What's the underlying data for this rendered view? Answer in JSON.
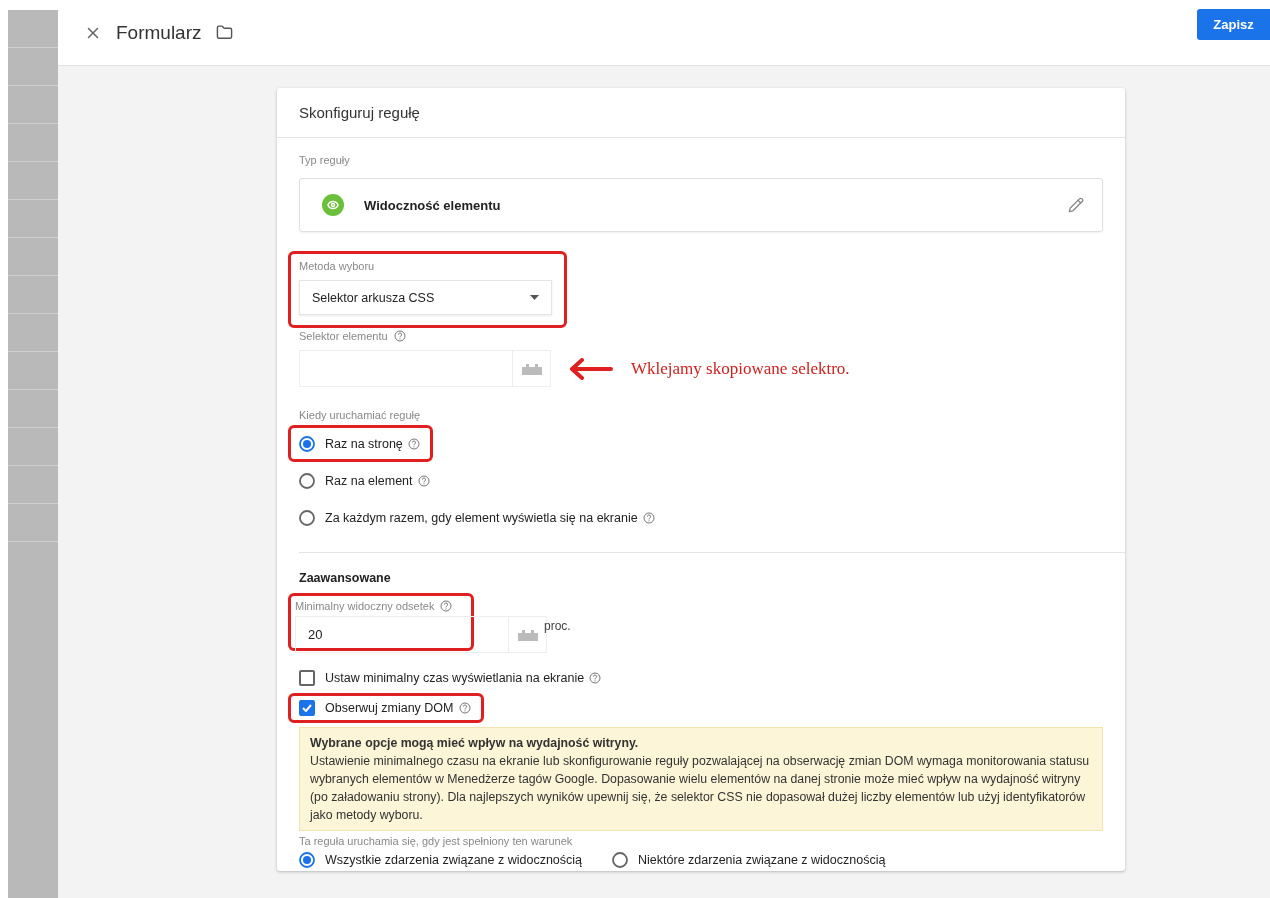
{
  "header": {
    "title": "Formularz",
    "save_button": "Zapisz"
  },
  "card": {
    "title": "Skonfiguruj regułę",
    "rule_type": {
      "label": "Typ reguły",
      "value": "Widoczność elementu"
    },
    "selection_method": {
      "label": "Metoda wyboru",
      "value": "Selektor arkusza CSS",
      "highlighted": true
    },
    "element_selector": {
      "label": "Selektor elementu",
      "annotation": "Wklejamy skopiowane selektro."
    },
    "fire_when": {
      "label": "Kiedy uruchamiać regułę",
      "options": [
        {
          "label": "Raz na stronę",
          "selected": true,
          "help": true,
          "highlighted": true
        },
        {
          "label": "Raz na element",
          "selected": false,
          "help": true,
          "highlighted": false
        },
        {
          "label": "Za każdym razem, gdy element wyświetla się na ekranie",
          "selected": false,
          "help": true,
          "highlighted": false
        }
      ]
    },
    "advanced": {
      "title": "Zaawansowane",
      "min_percent": {
        "label": "Minimalny widoczny odsetek",
        "value": "20",
        "unit": "proc.",
        "highlighted": true
      },
      "checkboxes": [
        {
          "label": "Ustaw minimalny czas wyświetlania na ekranie",
          "checked": false,
          "highlighted": false
        },
        {
          "label": "Obserwuj zmiany DOM",
          "checked": true,
          "highlighted": true
        }
      ],
      "warning": {
        "title": "Wybrane opcje mogą mieć wpływ na wydajność witryny.",
        "text": "Ustawienie minimalnego czasu na ekranie lub skonfigurowanie reguły pozwalającej na obserwację zmian DOM wymaga monitorowania statusu wybranych elementów w Menedżerze tagów Google. Dopasowanie wielu elementów na danej stronie może mieć wpływ na wydajność witryny (po załadowaniu strony). Dla najlepszych wyników upewnij się, że selektor CSS nie dopasował dużej liczby elementów lub użyj identyfikatorów jako metody wyboru."
      }
    },
    "condition": {
      "label": "Ta reguła uruchamia się, gdy jest spełniony ten warunek",
      "options": [
        {
          "label": "Wszystkie zdarzenia związane z widocznością",
          "selected": true
        },
        {
          "label": "Niektóre zdarzenia związane z widocznością",
          "selected": false
        }
      ]
    }
  }
}
